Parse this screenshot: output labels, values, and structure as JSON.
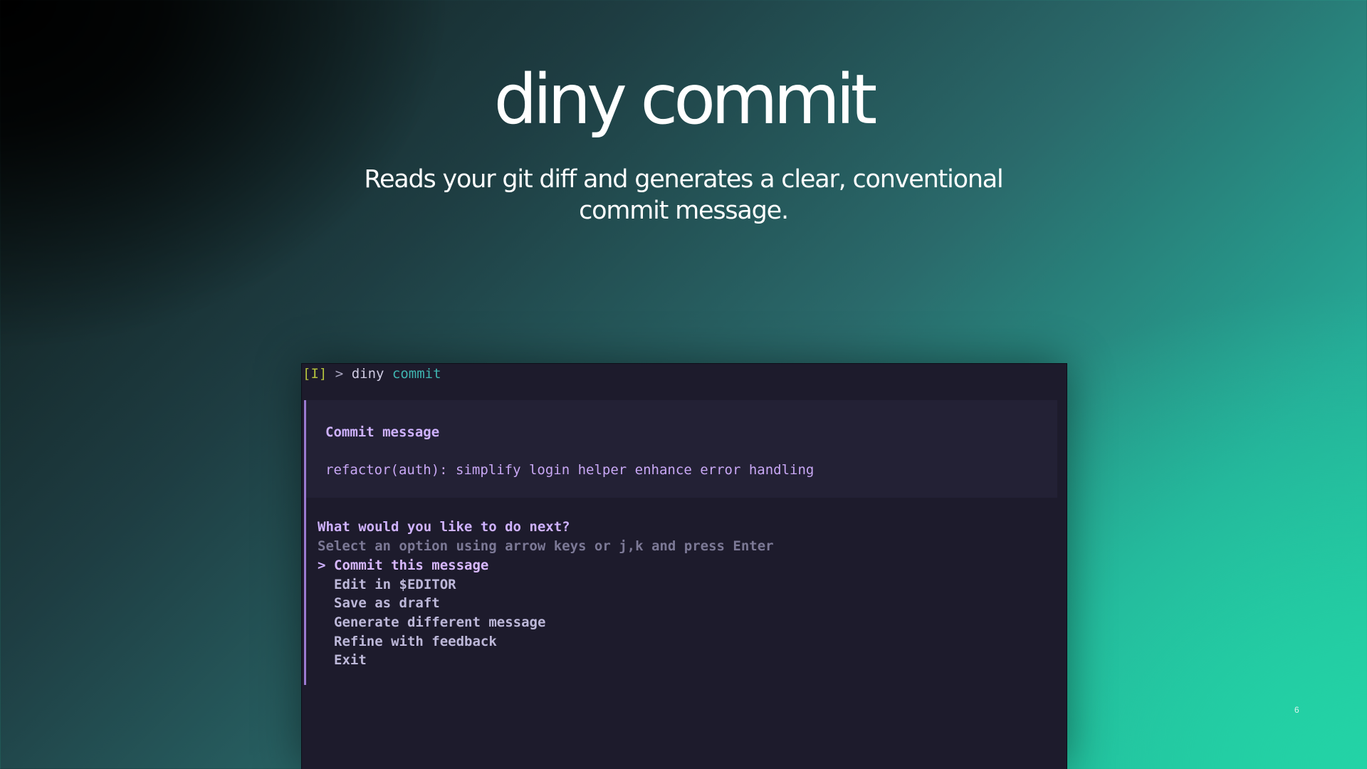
{
  "hero": {
    "title": "diny commit",
    "subtitle": "Reads your git diff and generates a clear, conventional commit message."
  },
  "terminal": {
    "prompt": {
      "mode": "[I]",
      "symbol": ">",
      "command": "diny",
      "argument": "commit"
    },
    "commit_panel": {
      "label": "Commit message",
      "message": "refactor(auth): simplify login helper enhance error handling"
    },
    "menu": {
      "question": "What would you like to do next?",
      "hint": "Select an option using arrow keys or j,k and press Enter",
      "cursor": ">",
      "options": [
        "Commit this message",
        "Edit in $EDITOR",
        "Save as draft",
        "Generate different message",
        "Refine with feedback",
        "Exit"
      ]
    }
  },
  "slide": {
    "number": "6"
  },
  "colors": {
    "terminal_bg": "#1d1b2c",
    "panel_bg": "#232135",
    "accent_purple": "#cfb2ff",
    "rail_purple": "#9b7ad1",
    "prompt_mode_green": "#b5c33d",
    "prompt_arg_cyan": "#3fb6b1",
    "hint_gray": "#7c7996"
  }
}
